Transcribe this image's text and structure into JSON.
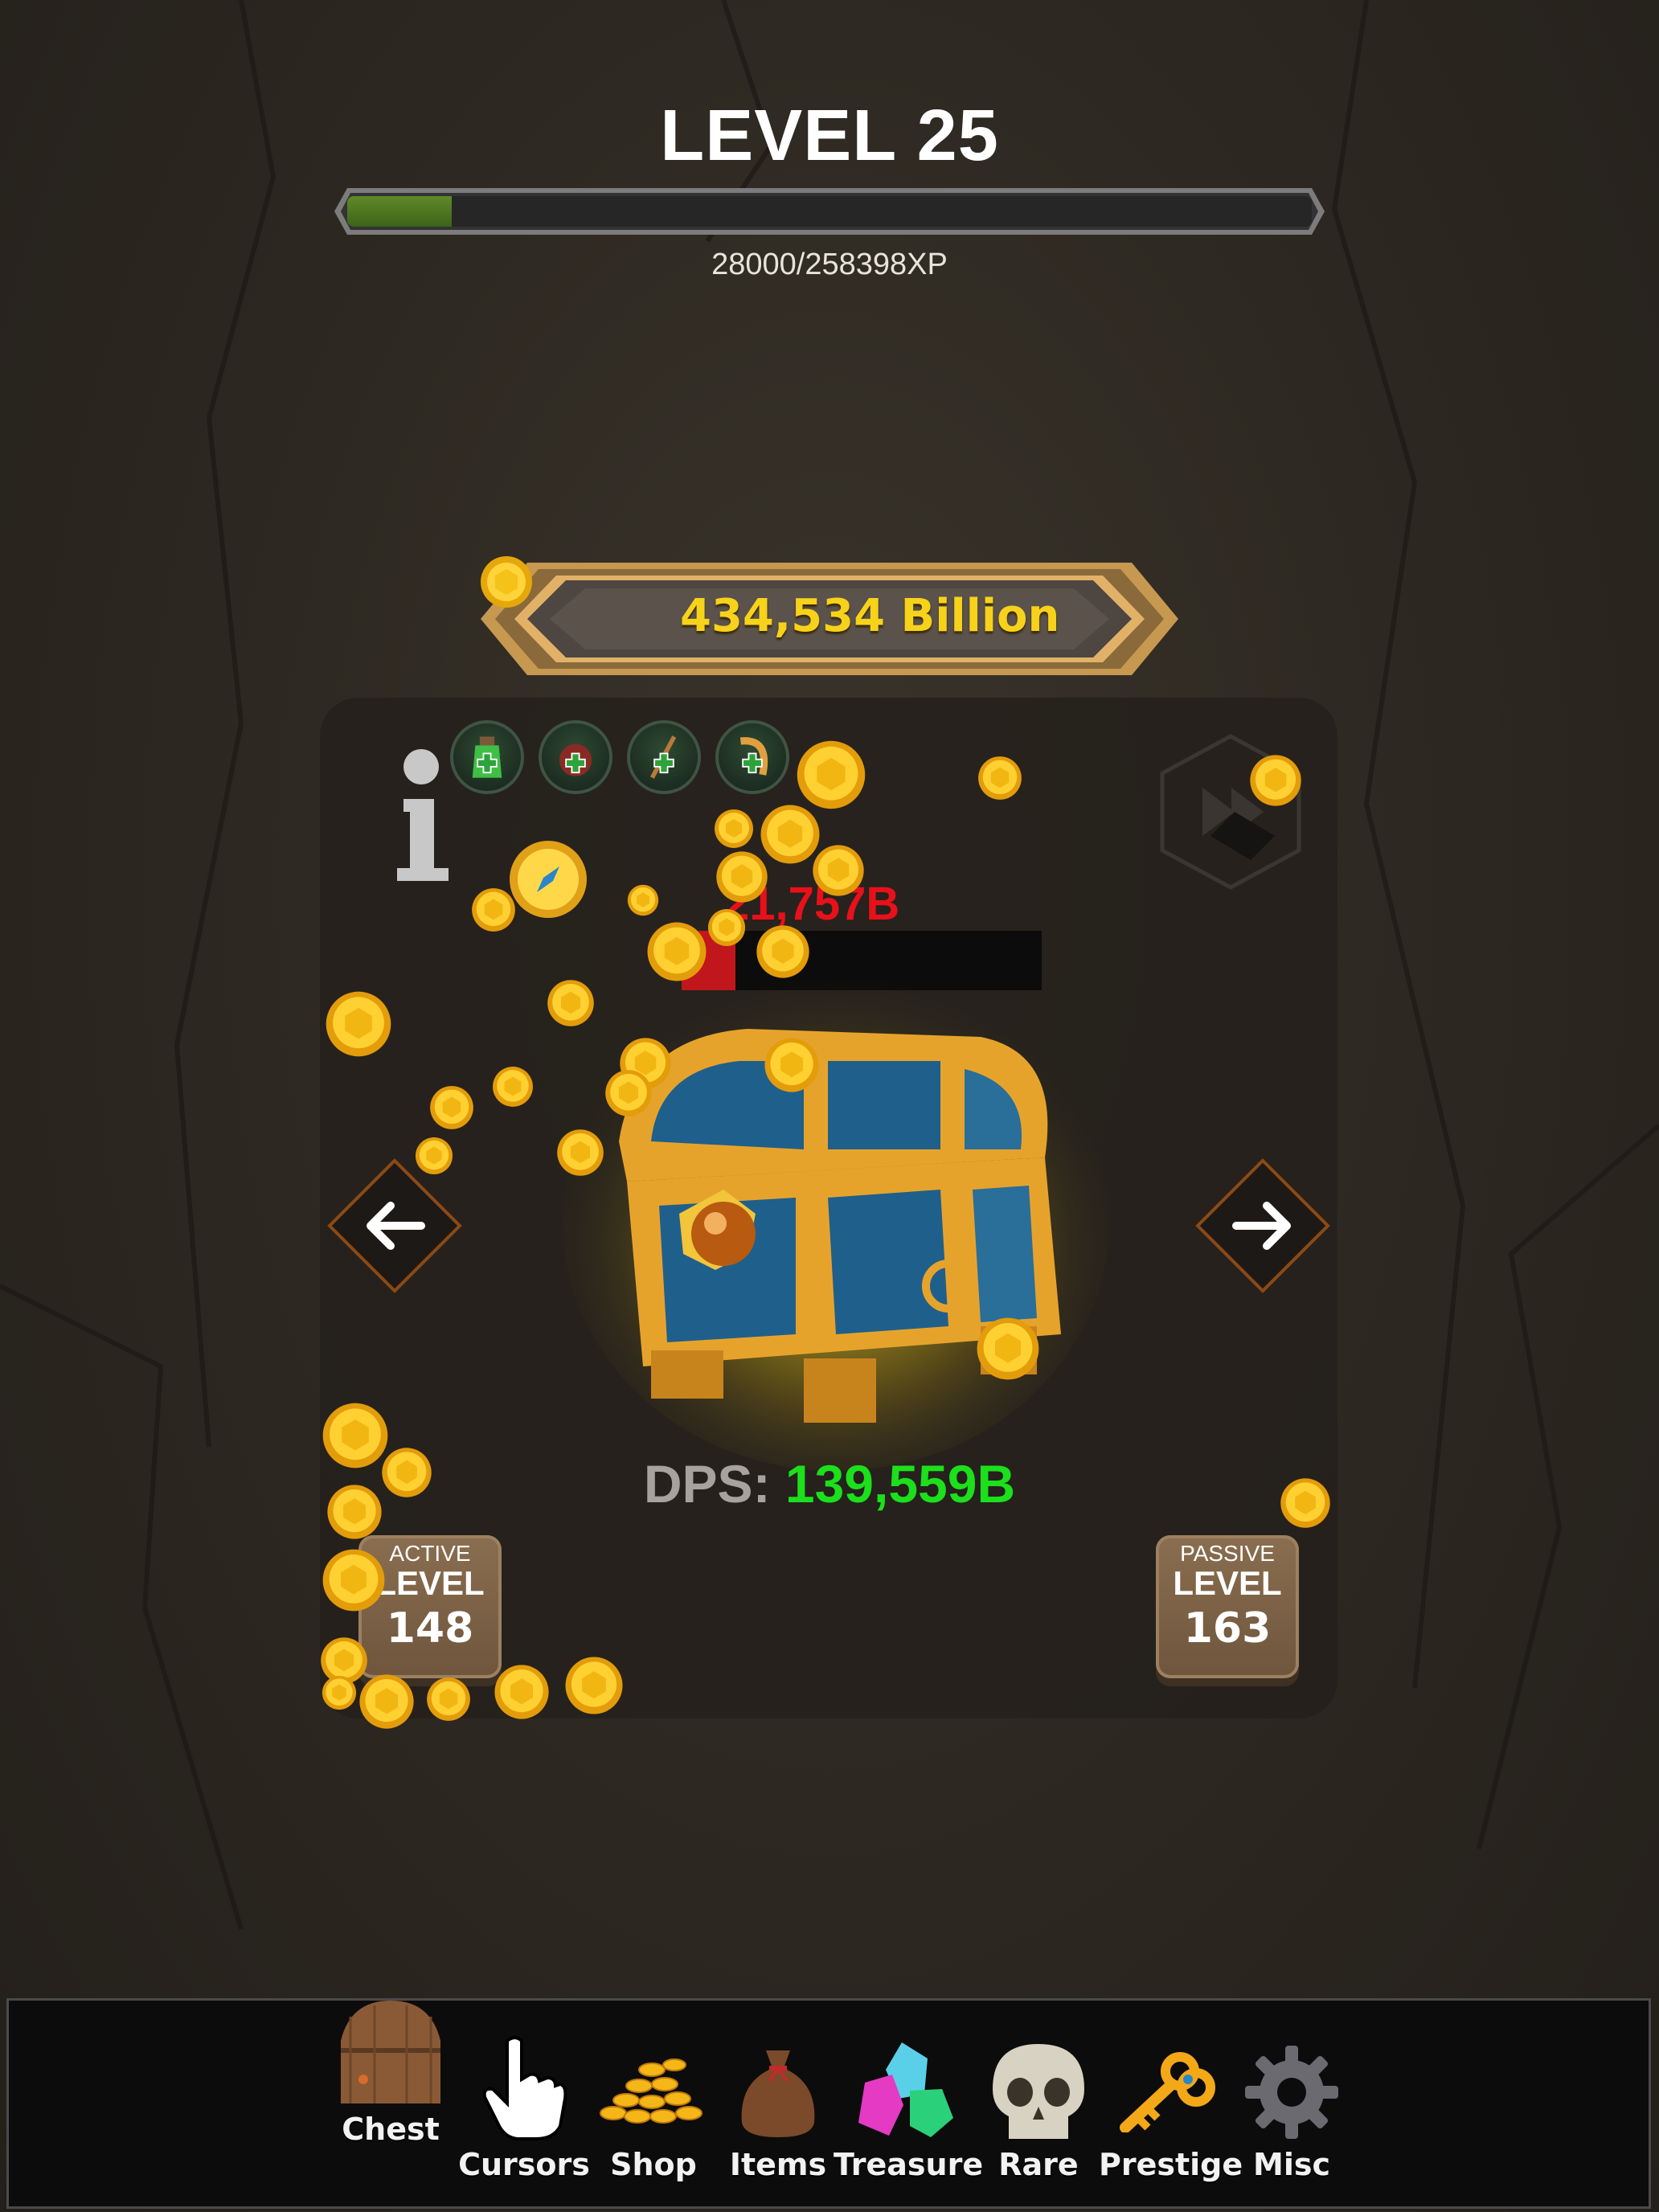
{
  "header": {
    "level_title": "LEVEL 25",
    "xp_current": 28000,
    "xp_max": 258398,
    "xp_text": "28000/258398XP"
  },
  "currency": {
    "amount": "434,534 Billion",
    "icon": "gold-coin-icon"
  },
  "buffs": [
    {
      "name": "green-potion-icon"
    },
    {
      "name": "red-flask-icon"
    },
    {
      "name": "wand-icon"
    },
    {
      "name": "horn-icon"
    }
  ],
  "enemy": {
    "hp_text": "21,757B",
    "hp_fraction": 0.15
  },
  "dps": {
    "label": "DPS:",
    "value": "139,559B"
  },
  "active_badge": {
    "kind": "ACTIVE",
    "level_word": "LEVEL",
    "level": "148"
  },
  "passive_badge": {
    "kind": "PASSIVE",
    "level_word": "LEVEL",
    "level": "163"
  },
  "bottom_nav": [
    {
      "label": "Chest",
      "icon": "chest-icon"
    },
    {
      "label": "Cursors",
      "icon": "pointer-hand-icon"
    },
    {
      "label": "Shop",
      "icon": "coin-pile-icon"
    },
    {
      "label": "Items",
      "icon": "loot-bag-icon"
    },
    {
      "label": "Treasure",
      "icon": "gems-icon"
    },
    {
      "label": "Rare",
      "icon": "skull-icon"
    },
    {
      "label": "Prestige",
      "icon": "key-icon"
    },
    {
      "label": "Misc",
      "icon": "gear-icon"
    }
  ],
  "colors": {
    "xp_fill": "#4f7a22",
    "currency_text": "#f7d21a",
    "hp_text": "#e8101a",
    "dps_value": "#1be01b"
  }
}
